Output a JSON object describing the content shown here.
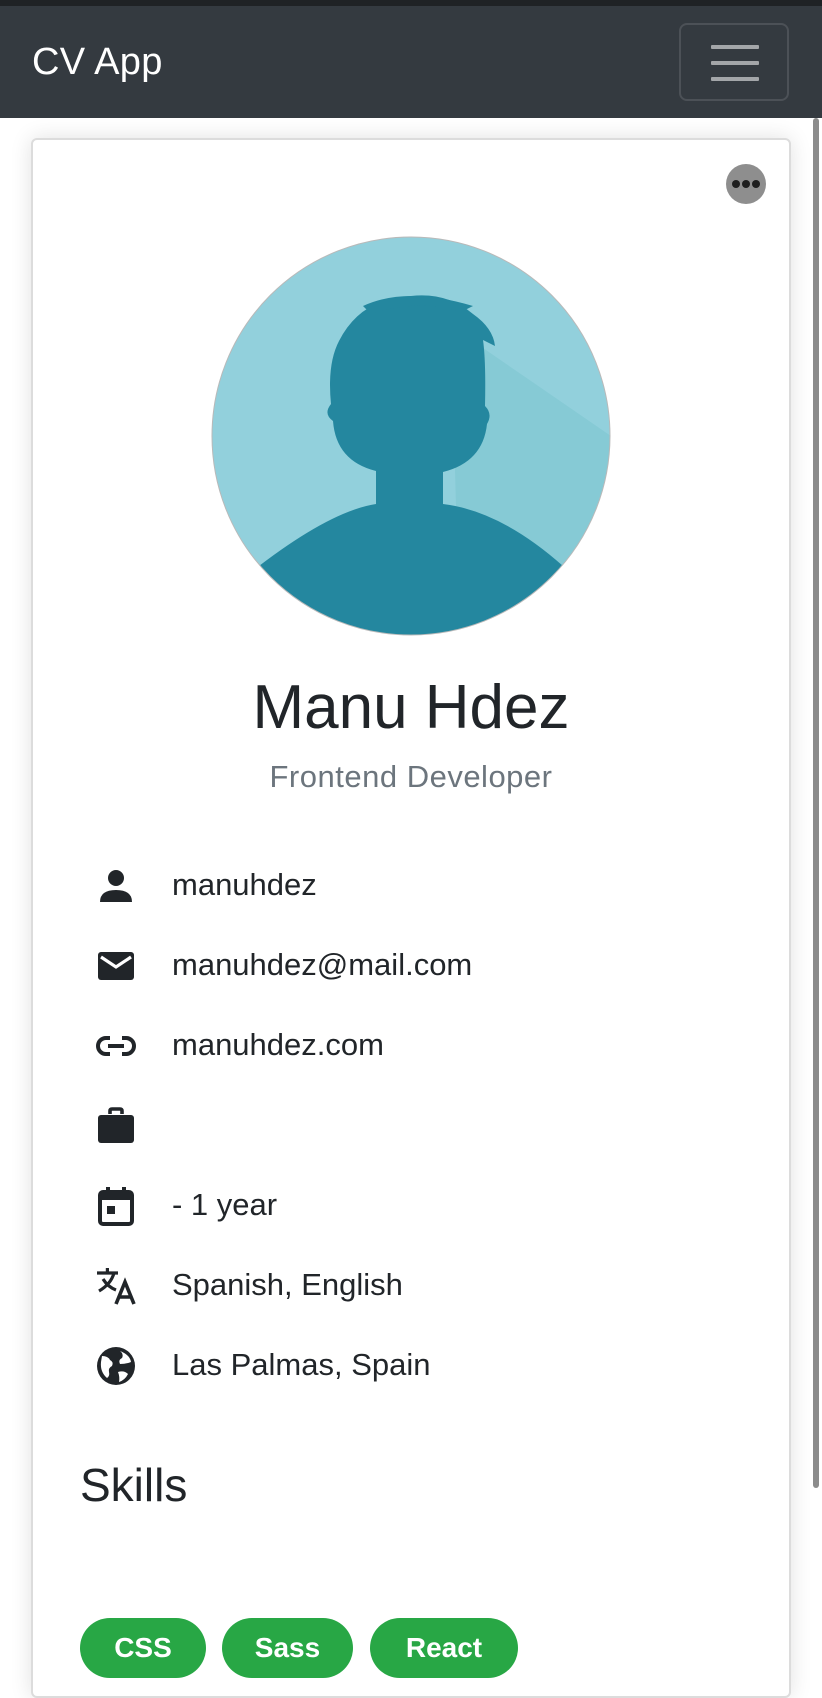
{
  "navbar": {
    "brand": "CV App",
    "toggler_icon": "hamburger-icon"
  },
  "card": {
    "more_icon": "more-horizontal-icon",
    "avatar_icon": "default-user-avatar",
    "name": "Manu Hdez",
    "role": "Frontend Developer"
  },
  "info": [
    {
      "icon": "person-icon",
      "text": "manuhdez"
    },
    {
      "icon": "email-icon",
      "text": "manuhdez@mail.com"
    },
    {
      "icon": "link-icon",
      "text": "manuhdez.com"
    },
    {
      "icon": "briefcase-icon",
      "text": ""
    },
    {
      "icon": "calendar-icon",
      "text": "- 1 year"
    },
    {
      "icon": "translate-icon",
      "text": "Spanish, English"
    },
    {
      "icon": "globe-icon",
      "text": "Las Palmas, Spain"
    }
  ],
  "skills": {
    "title": "Skills",
    "items": [
      "CSS",
      "Sass",
      "React"
    ]
  },
  "colors": {
    "navbar_bg": "#343a40",
    "badge_green": "#28a745",
    "avatar_light": "#92d0dc",
    "avatar_dark": "#24879f"
  }
}
